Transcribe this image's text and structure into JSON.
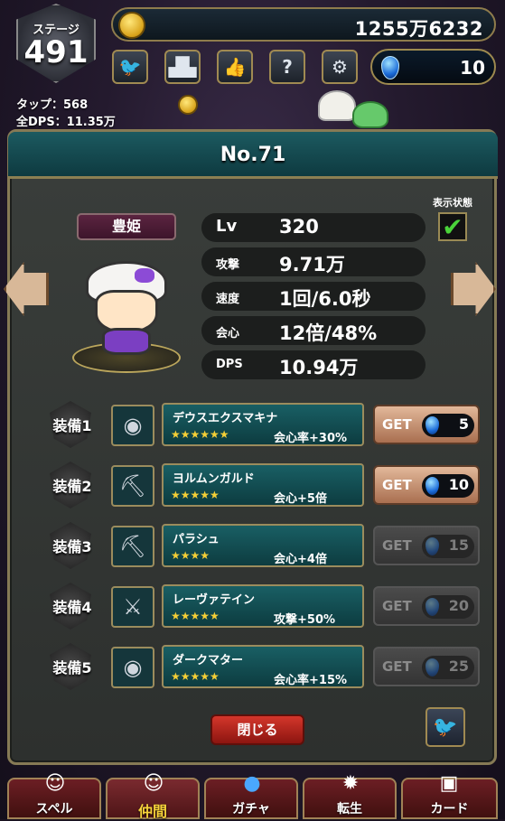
{
  "hud": {
    "stage_label": "ステージ",
    "stage_number": "491",
    "tap": "タップ：568",
    "dps": "全DPS：11.35万",
    "gold": "1255万6232",
    "gems": "10"
  },
  "panel": {
    "title": "No.71",
    "display_label": "表示状態",
    "character_name": "豊姫",
    "stats": [
      {
        "label": "Lv",
        "value": "320"
      },
      {
        "label": "攻撃",
        "value": "9.71万"
      },
      {
        "label": "速度",
        "value": "1回/6.0秒"
      },
      {
        "label": "会心",
        "value": "12倍/48%"
      },
      {
        "label": "DPS",
        "value": "10.94万"
      }
    ],
    "equipment": [
      {
        "slot": "装備1",
        "name": "デウスエクスマキナ",
        "stars": "★★★★★★",
        "effect": "会心率+30%",
        "get_label": "GET",
        "cost": "5",
        "enabled": true
      },
      {
        "slot": "装備2",
        "name": "ヨルムンガルド",
        "stars": "★★★★★",
        "effect": "会心+5倍",
        "get_label": "GET",
        "cost": "10",
        "enabled": true
      },
      {
        "slot": "装備3",
        "name": "パラシュ",
        "stars": "★★★★",
        "effect": "会心+4倍",
        "get_label": "GET",
        "cost": "15",
        "enabled": false
      },
      {
        "slot": "装備4",
        "name": "レーヴァテイン",
        "stars": "★★★★★",
        "effect": "攻撃+50%",
        "get_label": "GET",
        "cost": "20",
        "enabled": false
      },
      {
        "slot": "装備5",
        "name": "ダークマター",
        "stars": "★★★★★",
        "effect": "会心率+15%",
        "get_label": "GET",
        "cost": "25",
        "enabled": false
      }
    ],
    "close_label": "閉じる"
  },
  "nav": {
    "items": [
      {
        "label": "スペル"
      },
      {
        "label": "仲間"
      },
      {
        "label": "ガチャ"
      },
      {
        "label": "転生"
      },
      {
        "label": "カード"
      }
    ]
  },
  "icons": {
    "twitter": "twitter-icon",
    "ranking": "ranking-icon",
    "thumbs_up": "thumbs-up-icon",
    "help": "help-icon",
    "settings": "gear-icon"
  },
  "colors": {
    "header_teal": "#1c5a60",
    "gold_star": "#f5cf36",
    "close_red": "#d4362b",
    "check_green": "#4ad43a"
  }
}
